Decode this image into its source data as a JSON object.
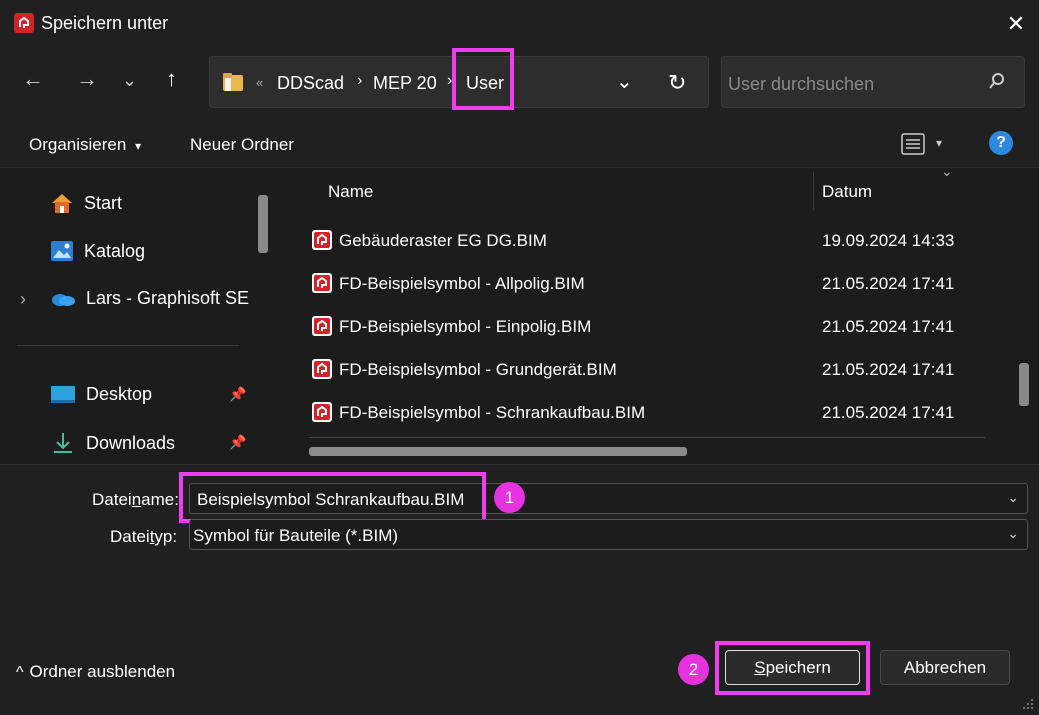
{
  "window": {
    "title": "Speichern unter",
    "close_glyph": "✕"
  },
  "nav": {
    "back": "←",
    "forward": "→",
    "recent": "⌄",
    "up": "↑",
    "address": {
      "overflow": "«",
      "crumbs": [
        "DDScad",
        "MEP 20",
        "User"
      ],
      "separator": "›",
      "dropdown": "⌄",
      "refresh": "↻"
    },
    "search_placeholder": "User durchsuchen"
  },
  "commands": {
    "organize": "Organisieren",
    "organize_caret": "▾",
    "new_folder": "Neuer Ordner",
    "view_caret": "▾",
    "help": "?"
  },
  "sidebar": {
    "items": [
      {
        "label": "Start",
        "icon": "home-icon"
      },
      {
        "label": "Katalog",
        "icon": "gallery-icon"
      },
      {
        "label": "Lars - Graphisoft SE",
        "icon": "onedrive-icon",
        "expander": "›"
      },
      {
        "label": "Desktop",
        "icon": "desktop-icon",
        "pin": "📌"
      },
      {
        "label": "Downloads",
        "icon": "download-icon",
        "pin": "📌"
      }
    ]
  },
  "files": {
    "columns": {
      "name": "Name",
      "date": "Datum"
    },
    "rows": [
      {
        "name": "Gebäuderaster EG DG.BIM",
        "date": "19.09.2024 14:33"
      },
      {
        "name": "FD-Beispielsymbol - Allpolig.BIM",
        "date": "21.05.2024 17:41"
      },
      {
        "name": "FD-Beispielsymbol - Einpolig.BIM",
        "date": "21.05.2024 17:41"
      },
      {
        "name": "FD-Beispielsymbol - Grundgerät.BIM",
        "date": "21.05.2024 17:41"
      },
      {
        "name": "FD-Beispielsymbol - Schrankaufbau.BIM",
        "date": "21.05.2024 17:41"
      }
    ]
  },
  "form": {
    "filename_label_pre": "Datei",
    "filename_label_u": "n",
    "filename_label_post": "ame:",
    "filename_value": "Beispielsymbol Schrankaufbau.BIM",
    "filetype_label_pre": "Datei",
    "filetype_label_u": "t",
    "filetype_label_post": "yp:",
    "filetype_value": "Symbol für Bauteile (*.BIM)",
    "dropdown_glyph": "⌄"
  },
  "footer": {
    "hide_folders": "Ordner ausblenden",
    "hide_caret": "^",
    "save_u": "S",
    "save_rest": "peichern",
    "cancel": "Abbrechen"
  },
  "annotations": {
    "badge1": "1",
    "badge2": "2",
    "highlight_color": "#f23cf0"
  }
}
